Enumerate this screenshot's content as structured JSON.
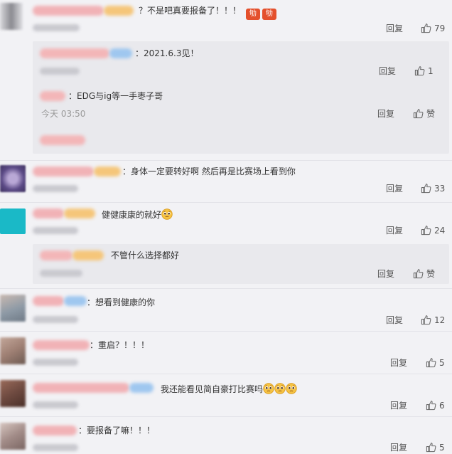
{
  "comments": [
    {
      "text_prefix": "？",
      "text": "不是吧真要报备了！！！",
      "badges": [
        "劬",
        "劬"
      ],
      "reply": "回复",
      "likes": "79"
    },
    {
      "text_prefix": "：",
      "text": "身体一定要转好啊 然后再是比赛场上看到你",
      "reply": "回复",
      "likes": "33"
    },
    {
      "text": "健健康康的就好",
      "reply": "回复",
      "likes": "24"
    },
    {
      "text_prefix": "：",
      "text": "想看到健康的你",
      "reply": "回复",
      "likes": "12"
    },
    {
      "text_prefix": "：",
      "text": "重启？！！！",
      "reply": "回复",
      "likes": "5"
    },
    {
      "text": "我还能看见简自豪打比赛吗",
      "reply": "回复",
      "likes": "6"
    },
    {
      "text_prefix": "：",
      "text": "要报备了嘛！！！",
      "reply": "回复",
      "likes": "5"
    }
  ],
  "replies": [
    {
      "text_prefix": "：",
      "text": "2021.6.3见！",
      "reply": "回复",
      "likes": "1"
    },
    {
      "text_prefix": "：",
      "text": "EDG与ig等一手枣子哥",
      "time": "今天 03:50",
      "reply": "回复",
      "likes": "赞"
    },
    {
      "text": "不管什么选择都好",
      "reply": "回复",
      "likes": "赞"
    }
  ],
  "colors": {
    "background": "#f2f2f5",
    "reply_box": "#e9e9ed",
    "text": "#333333",
    "meta": "#999999",
    "badge": "#e4502c",
    "emoji": "#f6c343"
  },
  "icons": {
    "like": "thumbs-up-icon",
    "emoji": "pleading-face-emoji-icon",
    "badge": "fighting-sticker-icon"
  }
}
